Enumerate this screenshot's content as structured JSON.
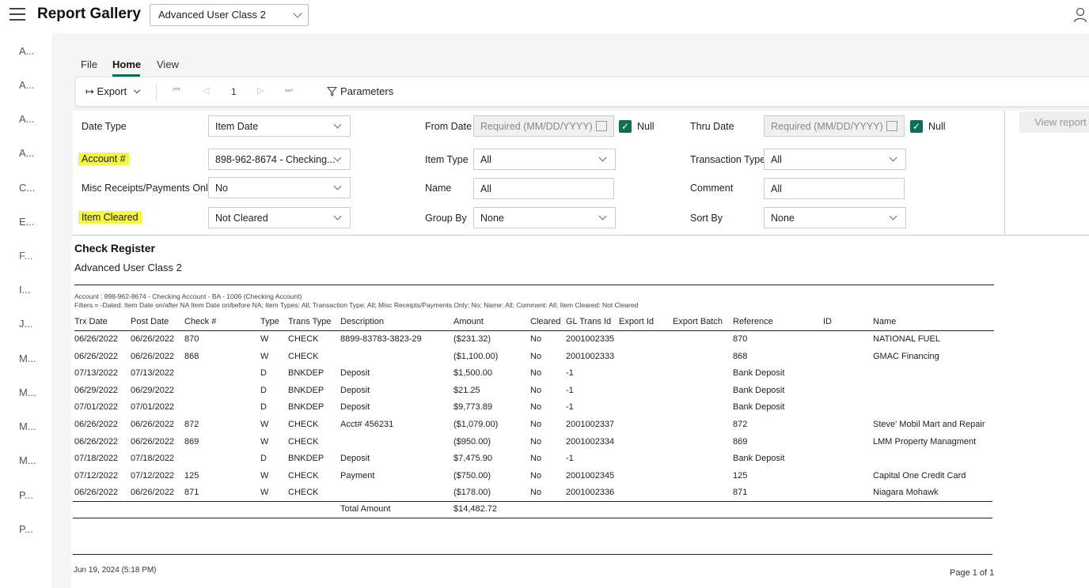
{
  "app": {
    "title": "Report Gallery",
    "gallery_selected": "Advanced User Class 2"
  },
  "left_rail": [
    "A...",
    "A...",
    "A...",
    "A...",
    "C...",
    "E...",
    "F...",
    "I...",
    "J...",
    "M...",
    "M...",
    "M...",
    "M...",
    "P...",
    "P..."
  ],
  "ribbon": {
    "tabs": [
      "File",
      "Home",
      "View"
    ],
    "export_label": "Export",
    "page_number": "1",
    "parameters_label": "Parameters"
  },
  "params": {
    "date_type": {
      "label": "Date Type",
      "value": "Item Date"
    },
    "account": {
      "label": "Account #",
      "value": "898-962-8674 - Checking..."
    },
    "misc": {
      "label": "Misc Receipts/Payments Only",
      "value": "No"
    },
    "item_cleared": {
      "label": "Item Cleared",
      "value": "Not Cleared"
    },
    "from_date": {
      "label": "From Date",
      "placeholder": "Required (MM/DD/YYYY)",
      "null_label": "Null"
    },
    "item_type": {
      "label": "Item Type",
      "value": "All"
    },
    "name": {
      "label": "Name",
      "value": "All"
    },
    "group_by": {
      "label": "Group By",
      "value": "None"
    },
    "thru_date": {
      "label": "Thru Date",
      "placeholder": "Required (MM/DD/YYYY)",
      "null_label": "Null"
    },
    "transaction_type": {
      "label": "Transaction Type",
      "value": "All"
    },
    "comment": {
      "label": "Comment",
      "value": "All"
    },
    "sort_by": {
      "label": "Sort By",
      "value": "None"
    },
    "view_report": "View report"
  },
  "report": {
    "title": "Check Register",
    "subtitle": "Advanced User Class 2",
    "account_line": "Account : 898-962-8674 - Checking Account - BA - 1006 (Checking Account)",
    "filters_line": "Filters = -Dated: Item Date on/after NA Item Date on/before NA; Item Types: All; Transaction Type: All; Misc Receipts/Payments Only: No; Name: All; Comment: All; Item Cleared: Not Cleared",
    "columns": [
      "Trx Date",
      "Post Date",
      "Check #",
      "Type",
      "Trans Type",
      "Description",
      "Amount",
      "Cleared",
      "GL Trans Id",
      "Export Id",
      "Export Batch",
      "Reference",
      "ID",
      "Name"
    ],
    "rows": [
      [
        "06/26/2022",
        "06/26/2022",
        "870",
        "W",
        "CHECK",
        "8899-83783-3823-29",
        "($231.32)",
        "No",
        "2001002335",
        "",
        "",
        "870",
        "",
        "NATIONAL FUEL"
      ],
      [
        "06/26/2022",
        "06/26/2022",
        "868",
        "W",
        "CHECK",
        "",
        "($1,100.00)",
        "No",
        "2001002333",
        "",
        "",
        "868",
        "",
        "GMAC Financing"
      ],
      [
        "07/13/2022",
        "07/13/2022",
        "",
        "D",
        "BNKDEP",
        "Deposit",
        "$1,500.00",
        "No",
        "-1",
        "",
        "",
        "Bank Deposit",
        "",
        ""
      ],
      [
        "06/29/2022",
        "06/29/2022",
        "",
        "D",
        "BNKDEP",
        "Deposit",
        "$21.25",
        "No",
        "-1",
        "",
        "",
        "Bank Deposit",
        "",
        ""
      ],
      [
        "07/01/2022",
        "07/01/2022",
        "",
        "D",
        "BNKDEP",
        "Deposit",
        "$9,773.89",
        "No",
        "-1",
        "",
        "",
        "Bank Deposit",
        "",
        ""
      ],
      [
        "06/26/2022",
        "06/26/2022",
        "872",
        "W",
        "CHECK",
        "Acct# 456231",
        "($1,079.00)",
        "No",
        "2001002337",
        "",
        "",
        "872",
        "",
        "Steve' Mobil Mart and Repair"
      ],
      [
        "06/26/2022",
        "06/26/2022",
        "869",
        "W",
        "CHECK",
        "",
        "($950.00)",
        "No",
        "2001002334",
        "",
        "",
        "869",
        "",
        "LMM Property Managment"
      ],
      [
        "07/18/2022",
        "07/18/2022",
        "",
        "D",
        "BNKDEP",
        "Deposit",
        "$7,475.90",
        "No",
        "-1",
        "",
        "",
        "Bank Deposit",
        "",
        ""
      ],
      [
        "07/12/2022",
        "07/12/2022",
        "125",
        "W",
        "CHECK",
        "Payment",
        "($750.00)",
        "No",
        "2001002345",
        "",
        "",
        "125",
        "",
        "Capital One Credit Card"
      ],
      [
        "06/26/2022",
        "06/26/2022",
        "871",
        "W",
        "CHECK",
        "",
        "($178.00)",
        "No",
        "2001002336",
        "",
        "",
        "871",
        "",
        "Niagara Mohawk"
      ]
    ],
    "total_label": "Total Amount",
    "total_value": "$14,482.72",
    "footer_date": "Jun 19, 2024 (5:18 PM)",
    "footer_page": "Page 1 of 1"
  }
}
